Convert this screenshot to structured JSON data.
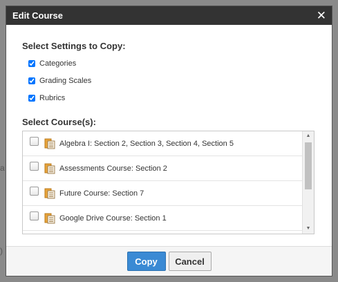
{
  "dialog": {
    "title": "Edit Course",
    "close_glyph": "✕"
  },
  "settings": {
    "heading": "Select Settings to Copy:",
    "options": [
      {
        "label": "Categories",
        "checked": true
      },
      {
        "label": "Grading Scales",
        "checked": true
      },
      {
        "label": "Rubrics",
        "checked": true
      }
    ]
  },
  "courses": {
    "heading": "Select Course(s):",
    "items": [
      {
        "label": "Algebra I: Section 2, Section 3, Section 4, Section 5",
        "checked": false
      },
      {
        "label": "Assessments Course: Section 2",
        "checked": false
      },
      {
        "label": "Future Course: Section 7",
        "checked": false
      },
      {
        "label": "Google Drive Course: Section 1",
        "checked": false
      }
    ]
  },
  "footer": {
    "copy_label": "Copy",
    "cancel_label": "Cancel"
  },
  "colors": {
    "titlebar": "#333333",
    "primary": "#3a8ad4"
  },
  "icons": {
    "close": "close-icon",
    "course": "course-icon",
    "scroll_up": "scroll-up-icon",
    "scroll_down": "scroll-down-icon"
  }
}
